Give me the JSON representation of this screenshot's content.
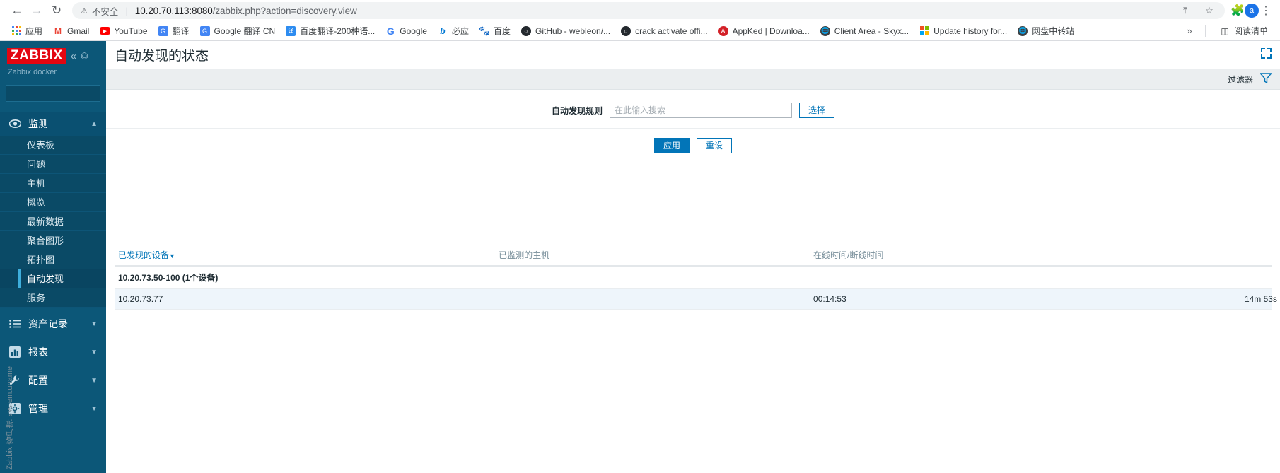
{
  "browser": {
    "nav": {
      "back_icon": "back-arrow-icon",
      "forward_icon": "forward-arrow-icon",
      "reload_icon": "reload-icon"
    },
    "omnibox": {
      "security_warning_icon": "warning-triangle-icon",
      "security_text": "不安全",
      "url": "10.20.70.113:8080/zabbix.php?action=discovery.view",
      "url_host": "10.20.70.113:8080",
      "url_path": "/zabbix.php?action=discovery.view",
      "share_icon": "share-icon",
      "bookmark_icon": "star-icon"
    },
    "extensions_icon": "puzzle-piece-icon",
    "profile_initial": "a",
    "menu_icon": "three-dot-menu-icon",
    "bookmarks": [
      {
        "label": "应用",
        "icon": "apps-grid-icon"
      },
      {
        "label": "Gmail",
        "icon": "gmail-icon"
      },
      {
        "label": "YouTube",
        "icon": "youtube-icon"
      },
      {
        "label": "翻译",
        "icon": "google-translate-icon"
      },
      {
        "label": "Google 翻译 CN",
        "icon": "google-translate-icon"
      },
      {
        "label": "百度翻译-200种语...",
        "icon": "baidu-translate-icon"
      },
      {
        "label": "Google",
        "icon": "google-icon"
      },
      {
        "label": "必应",
        "icon": "bing-icon"
      },
      {
        "label": "百度",
        "icon": "baidu-icon"
      },
      {
        "label": "GitHub - webleon/...",
        "icon": "github-icon"
      },
      {
        "label": "crack activate offi...",
        "icon": "github-icon"
      },
      {
        "label": "AppKed | Downloa...",
        "icon": "appked-icon"
      },
      {
        "label": "Client Area - Skyx...",
        "icon": "globe-icon"
      },
      {
        "label": "Update history for...",
        "icon": "microsoft-icon"
      },
      {
        "label": "网盘中转站",
        "icon": "globe-icon"
      }
    ],
    "bookmarks_overflow_icon": "chevron-double-right-icon",
    "reading_list": {
      "label": "阅读清单",
      "icon": "reading-list-icon"
    }
  },
  "sidebar": {
    "logo_text": "ZABBIX",
    "collapse_icon": "chevron-double-left-icon",
    "hide_icon": "collapse-panel-icon",
    "server_name": "Zabbix docker",
    "search": {
      "value": "",
      "placeholder": "",
      "icon": "search-icon"
    },
    "groups": [
      {
        "label": "监测",
        "icon": "eye-icon",
        "chevron": "chevron-up-icon",
        "expanded": true,
        "items": [
          {
            "label": "仪表板",
            "active": false
          },
          {
            "label": "问题",
            "active": false
          },
          {
            "label": "主机",
            "active": false
          },
          {
            "label": "概览",
            "active": false
          },
          {
            "label": "最新数据",
            "active": false
          },
          {
            "label": "聚合图形",
            "active": false
          },
          {
            "label": "拓扑图",
            "active": false
          },
          {
            "label": "自动发现",
            "active": true
          },
          {
            "label": "服务",
            "active": false
          }
        ]
      },
      {
        "label": "资产记录",
        "icon": "list-icon",
        "chevron": "chevron-down-icon",
        "expanded": false,
        "items": []
      },
      {
        "label": "报表",
        "icon": "bar-chart-icon",
        "chevron": "chevron-down-icon",
        "expanded": false,
        "items": []
      },
      {
        "label": "配置",
        "icon": "wrench-icon",
        "chevron": "chevron-down-icon",
        "expanded": false,
        "items": []
      },
      {
        "label": "管理",
        "icon": "gear-icon",
        "chevron": "chevron-down-icon",
        "expanded": false,
        "items": []
      }
    ]
  },
  "page": {
    "title": "自动发现的状态",
    "kiosk_icon": "fullscreen-icon"
  },
  "filter": {
    "tab_label": "过滤器",
    "funnel_icon": "funnel-icon",
    "field_label": "自动发现规则",
    "field_value": "",
    "field_placeholder": "在此输入搜索",
    "select_button": "选择",
    "apply_button": "应用",
    "reset_button": "重设"
  },
  "table": {
    "columns": {
      "device": "已发现的设备",
      "device_sort_icon": "sort-desc-arrow-icon",
      "host": "已监测的主机",
      "uptime": "在线时间/断线时间",
      "vertical_check": "Zabbix 客户端: system.uname"
    },
    "group_row": {
      "label": "10.20.73.50-100 (1个设备)"
    },
    "rows": [
      {
        "device": "10.20.73.77",
        "host": "",
        "uptime": "00:14:53",
        "check": "14m 53s"
      }
    ]
  }
}
